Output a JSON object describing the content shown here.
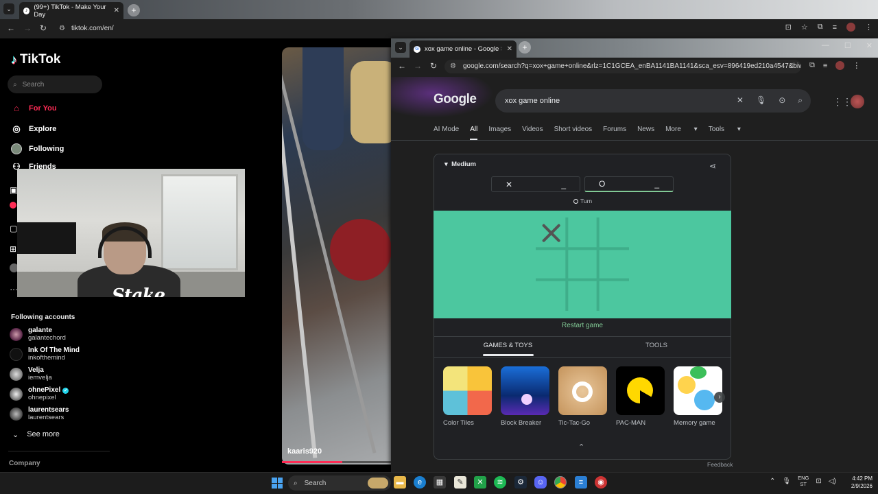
{
  "back_browser": {
    "tab_title": "(99+) TikTok - Make Your Day",
    "url": "tiktok.com/en/"
  },
  "tiktok": {
    "logo": "TikTok",
    "search_placeholder": "Search",
    "nav": [
      {
        "label": "For You",
        "icon": "home-icon"
      },
      {
        "label": "Explore",
        "icon": "compass-icon"
      },
      {
        "label": "Following",
        "icon": "avatar-icon"
      },
      {
        "label": "Friends",
        "icon": "friends-icon"
      }
    ],
    "following_header": "Following accounts",
    "accounts": [
      {
        "name": "galante",
        "handle": "galantechord"
      },
      {
        "name": "Ink Of The Mind",
        "handle": "inkofthemind"
      },
      {
        "name": "Velja",
        "handle": "iemvelja"
      },
      {
        "name": "ohnePixel",
        "handle": "ohnepixel",
        "verified": true
      },
      {
        "name": "laurentsears",
        "handle": "laurentsears"
      }
    ],
    "see_more": "See more",
    "company": "Company",
    "webcam_watermark": "Stake",
    "video_username": "kaaris920",
    "video_progress": 0.55
  },
  "front_browser": {
    "tab_title": "xox game online - Google Search",
    "url": "google.com/search?q=xox+game+online&rlz=1C1GCEA_enBA1141BA1141&sca_esv=896419ed210a4547&biw..."
  },
  "google": {
    "logo": "Google",
    "query": "xox game online",
    "tabs": [
      "AI Mode",
      "All",
      "Images",
      "Videos",
      "Short videos",
      "Forums",
      "News",
      "More",
      "Tools"
    ],
    "active_tab": "All",
    "game": {
      "difficulty": "Medium",
      "player_x": {
        "mark": "✕",
        "score": "_"
      },
      "player_o": {
        "mark": "O",
        "score": "_"
      },
      "turn_label": "Turn",
      "board_color": "#4cc79f",
      "board": [
        "X",
        "",
        "",
        "",
        "",
        "",
        "",
        "",
        ""
      ],
      "restart": "Restart game"
    },
    "section_tabs": [
      "GAMES & TOYS",
      "TOOLS"
    ],
    "games": [
      "Color Tiles",
      "Block Breaker",
      "Tic-Tac-Go",
      "PAC-MAN",
      "Memory game"
    ],
    "feedback": "Feedback"
  },
  "taskbar": {
    "search_label": "Search",
    "lang_line1": "ENG",
    "lang_line2": "ST",
    "time": "4:42 PM",
    "date": "2/9/2026"
  }
}
